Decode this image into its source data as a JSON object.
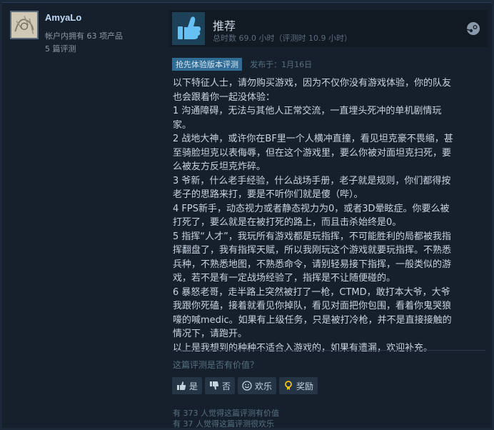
{
  "author": {
    "name": "AmyaLo",
    "products": "帐户内拥有 63 项产品",
    "reviews": "5 篇评测"
  },
  "verdict": {
    "title": "推荐",
    "hours": "总时数 69.0 小时（评测时 10.9 小时）"
  },
  "meta": {
    "badge": "抢先体验版本评测",
    "posted": "发布于：1月16日"
  },
  "review_lines": [
    "以下特征人士，请勿购买游戏，因为不仅你没有游戏体验，你的队友",
    "也会跟着你一起没体验：",
    "1 沟通障碍，无法与其他人正常交流，一直埋头死冲的单机剧情玩",
    "家。",
    "2 战地大神，或许你在BF里一个人横冲直撞，看见坦克豪不畏缩，甚",
    "至骑脸坦克以表侮辱，但在这个游戏里，要么你被对面坦克扫死，要",
    "么被友方反坦克炸碎。",
    "3 爷新，什么老手经验，什么战场手册，老子就是规则，你们都得按",
    "老子的思路来打，要是不听你们就是傻（哔）。",
    "4 FPS新手，动态视力或者静态视力为0，或者3D晕眩症。你要么被",
    "打死了，要么就是在被打死的路上，而且击杀始终是0。",
    "5 指挥“人才”，我玩所有游戏都是玩指挥，不可能胜利的局都被我指",
    "挥翻盘了，我有指挥天赋，所以我刚玩这个游戏就要玩指挥。不熟悉",
    "兵种，不熟悉地图，不熟悉命令，请别轻易接下指挥，一般类似的游",
    "戏，若不是有一定战场经验了，指挥是不让随便碰的。",
    "6 暴怒老哥，走半路上突然被打了一枪，CTMD，敢打本大爷，大爷",
    "我跟你死磕，接着就看见你掉队，看见对面把你包围，看着你鬼哭狼",
    "嚎的喊medic。如果有上级任务，只是被打冷枪，并不是直接接触的",
    "情况下，请跑开。",
    "以上是我想到的种种不适合入游戏的，如果有遗漏，欢迎补充。"
  ],
  "feedback": {
    "question": "这篇评测是否有价值？",
    "yes": "是",
    "no": "否",
    "funny": "欢乐",
    "award": "奖励",
    "helpful_count": "有 373 人觉得这篇评测有价值",
    "funny_count": "有 37 人觉得这篇评测很欢乐"
  },
  "icons": {
    "thumb": "thumbs-up-icon",
    "steam": "steam-icon",
    "yes": "thumbs-up-icon",
    "no": "thumbs-down-icon",
    "funny": "smiley-icon",
    "award": "award-icon"
  },
  "colors": {
    "background": "#1b2838",
    "author_name": "#c1dbf4",
    "thumb_blue": "#66c0f4",
    "badge": "#2f6d96"
  }
}
